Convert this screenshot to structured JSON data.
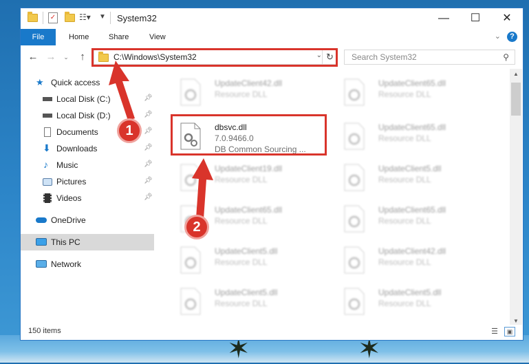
{
  "window": {
    "title": "System32"
  },
  "ribbon": {
    "tabs": [
      "File",
      "Home",
      "Share",
      "View"
    ],
    "help_icon": "question-icon"
  },
  "nav": {
    "address": "C:\\Windows\\System32",
    "search_placeholder": "Search System32"
  },
  "sidebar": {
    "items": [
      {
        "label": "Quick access",
        "icon": "star-icon",
        "pinned": false
      },
      {
        "label": "Local Disk (C:)",
        "icon": "drive-icon",
        "pinned": true
      },
      {
        "label": "Local Disk (D:)",
        "icon": "drive-icon",
        "pinned": true
      },
      {
        "label": "Documents",
        "icon": "document-icon",
        "pinned": true
      },
      {
        "label": "Downloads",
        "icon": "download-icon",
        "pinned": true
      },
      {
        "label": "Music",
        "icon": "music-icon",
        "pinned": true
      },
      {
        "label": "Pictures",
        "icon": "picture-icon",
        "pinned": true
      },
      {
        "label": "Videos",
        "icon": "video-icon",
        "pinned": true
      },
      {
        "label": "OneDrive",
        "icon": "cloud-icon",
        "pinned": false
      },
      {
        "label": "This PC",
        "icon": "computer-icon",
        "pinned": false,
        "selected": true
      },
      {
        "label": "Network",
        "icon": "network-icon",
        "pinned": false
      }
    ]
  },
  "files": [
    {
      "name": "UpdateClient42.dll",
      "desc": "Resource DLL",
      "faded": true
    },
    {
      "name": "UpdateClient65.dll",
      "desc": "Resource DLL",
      "faded": true
    },
    {
      "name": "dbsvc.dll",
      "version": "7.0.9466.0",
      "desc": "DB Common Sourcing ...",
      "faded": false
    },
    {
      "name": "UpdateClient65.dll",
      "desc": "Resource DLL",
      "faded": true
    },
    {
      "name": "UpdateClient19.dll",
      "desc": "Resource DLL",
      "faded": true
    },
    {
      "name": "UpdateClient5.dll",
      "desc": "Resource DLL",
      "faded": true
    },
    {
      "name": "UpdateClient65.dll",
      "desc": "Resource DLL",
      "faded": true
    },
    {
      "name": "UpdateClient65.dll",
      "desc": "Resource DLL",
      "faded": true
    },
    {
      "name": "UpdateClient5.dll",
      "desc": "Resource DLL",
      "faded": true
    },
    {
      "name": "UpdateClient42.dll",
      "desc": "Resource DLL",
      "faded": true
    },
    {
      "name": "UpdateClient5.dll",
      "desc": "Resource DLL",
      "faded": true
    },
    {
      "name": "UpdateClient5.dll",
      "desc": "Resource DLL",
      "faded": true
    }
  ],
  "status": {
    "item_count": "150 items"
  },
  "callouts": [
    "1",
    "2"
  ],
  "colors": {
    "accent": "#1979ca",
    "highlight": "#d9342b",
    "selected_bg": "#d9d9d9"
  }
}
